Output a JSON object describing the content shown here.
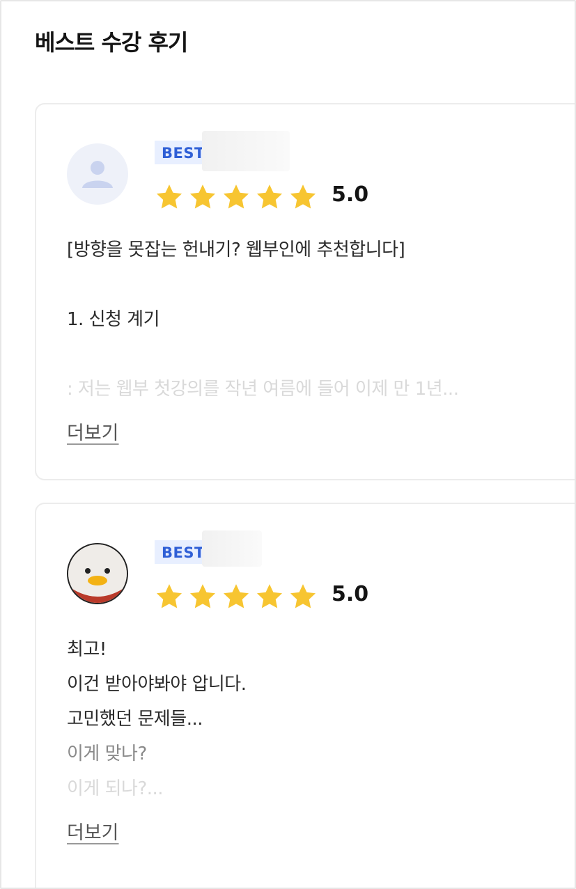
{
  "section": {
    "title": "베스트 수강 후기"
  },
  "reviews": [
    {
      "badge": "BEST",
      "rating": "5.0",
      "stars": 5,
      "lines": [
        "[방향을 못잡는 헌내기? 웹부인에 추천합니다]",
        "",
        "1. 신청 계기",
        "",
        ": 저는 웹부 첫강의를 작년 여름에 들어 이제 만 1년..."
      ],
      "more_label": "더보기"
    },
    {
      "badge": "BEST",
      "rating": "5.0",
      "stars": 5,
      "lines": [
        "최고!",
        "이건 받아야봐야 압니다.",
        "고민했던 문제들...",
        "이게 맞나?",
        "이게 되나?..."
      ],
      "more_label": "더보기"
    }
  ],
  "colors": {
    "star": "#f7c531",
    "badge_bg": "#e8efff",
    "badge_text": "#2f5fd6"
  },
  "icons": {
    "default_avatar": "user-silhouette-icon",
    "star": "star-icon"
  }
}
